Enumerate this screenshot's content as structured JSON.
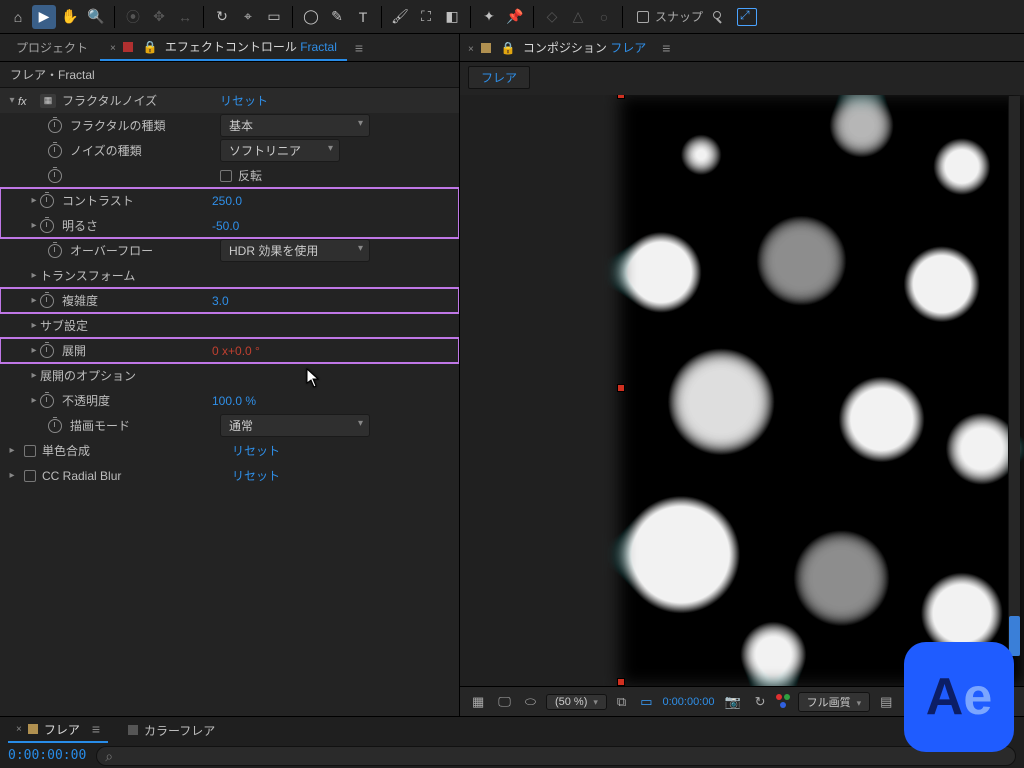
{
  "toolbar": {
    "snap_label": "スナップ"
  },
  "tabs": {
    "project": "プロジェクト",
    "effect_controls_prefix": "エフェクトコントロール",
    "effect_controls_layer": "Fractal",
    "comp_prefix": "コンポジション",
    "comp_name": "フレア",
    "mini_tab_flare": "フレア"
  },
  "breadcrumb": "フレア・Fractal",
  "effects": {
    "fractal_noise": {
      "name": "フラクタルノイズ",
      "reset": "リセット",
      "fractal_type_label": "フラクタルの種類",
      "fractal_type_value": "基本",
      "noise_type_label": "ノイズの種類",
      "noise_type_value": "ソフトリニア",
      "invert_label": "反転",
      "contrast_label": "コントラスト",
      "contrast_value": "250.0",
      "brightness_label": "明るさ",
      "brightness_value": "-50.0",
      "overflow_label": "オーバーフロー",
      "overflow_value": "HDR 効果を使用",
      "transform_label": "トランスフォーム",
      "complexity_label": "複雑度",
      "complexity_value": "3.0",
      "sub_settings_label": "サブ設定",
      "evolution_label": "展開",
      "evolution_value": "0 x+0.0 °",
      "evolution_options_label": "展開のオプション",
      "opacity_label": "不透明度",
      "opacity_value": "100.0 %",
      "blend_mode_label": "描画モード",
      "blend_mode_value": "通常"
    },
    "tint": {
      "name": "単色合成",
      "reset": "リセット"
    },
    "cc_radial_blur": {
      "name": "CC Radial Blur",
      "reset": "リセット"
    }
  },
  "viewer": {
    "zoom": "(50 %)",
    "time": "0:00:00:00",
    "resolution": "フル画質"
  },
  "timeline": {
    "tab_flare": "フレア",
    "tab_colorflare": "カラーフレア",
    "timecode": "0:00:00:00"
  },
  "logo": {
    "a": "A",
    "e": "e"
  }
}
